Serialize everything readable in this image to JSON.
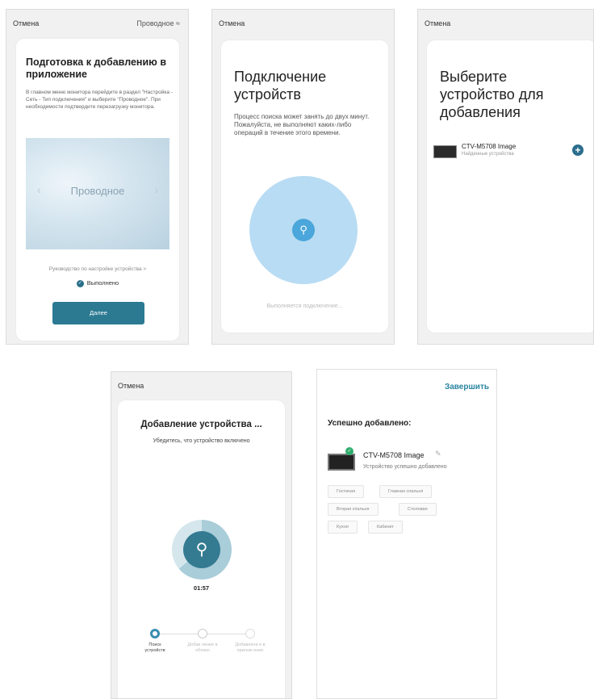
{
  "screen1": {
    "cancel": "Отмена",
    "mode": "Проводное ≈",
    "title": "Подготовка к добавлению в приложение",
    "description": "В главном меню монитора перейдите в раздел \"Настройка - Сеть - Тип подключения\" и выберите \"Проводное\". При необходимости подтвердите перезагрузку монитора.",
    "image_label": "Проводное",
    "guide_link": "Руководство по настройке устройства >",
    "done_label": "Выполнено",
    "next_button": "Далее"
  },
  "screen2": {
    "cancel": "Отмена",
    "title": "Подключение устройств",
    "description": "Процесс поиска может занять до двух минут. Пожалуйста, не выполняют каких-либо операций в течение этого времени.",
    "status": "Выполняется подключение..."
  },
  "screen3": {
    "cancel": "Отмена",
    "title": "Выберите устройство для добавления",
    "device_name": "CTV-M5708 Image",
    "device_sub": "Найденные устройства"
  },
  "screen4": {
    "cancel": "Отмена",
    "title": "Добавление устройства ...",
    "subtitle": "Убедитесь, что устройство включено",
    "timer": "01:57",
    "steps": [
      "Поиск устройств",
      "Добав ление в облако",
      "Добавлени е в прилож ение"
    ]
  },
  "screen5": {
    "finish": "Завершить",
    "title": "Успешно добавлено:",
    "device_name": "CTV-M5708 Image",
    "device_sub": "Устройство успешно добавлено",
    "rooms": [
      "Гостиная",
      "Главная спальня",
      "Вторая спальня",
      "Столовая",
      "Кухня",
      "Кабинет"
    ]
  }
}
